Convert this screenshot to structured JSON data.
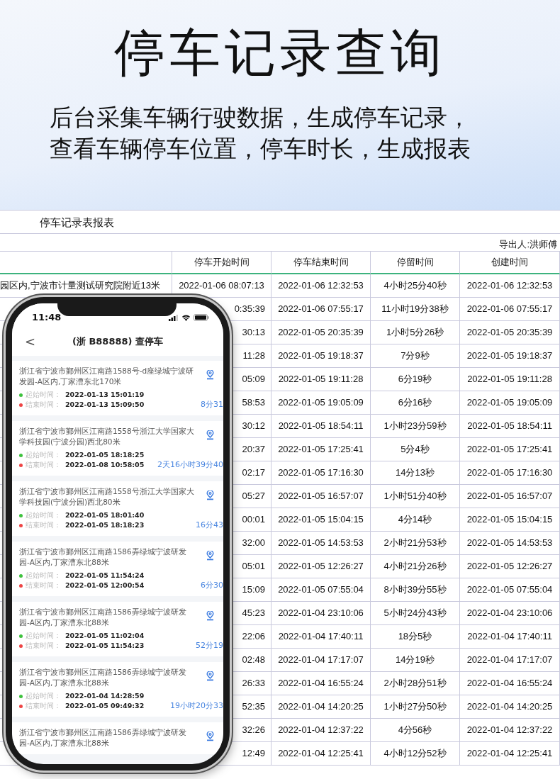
{
  "banner": {
    "title": "停车记录查询",
    "subtitle_lines": [
      "后台采集车辆行驶数据，生成停车记录，",
      "查看车辆停车位置，停车时长，生成报表"
    ]
  },
  "report": {
    "title": "停车记录表报表",
    "exporter": "导出人:洪师傅",
    "columns": [
      "",
      "停车开始时间",
      "停车结束时间",
      "停留时间",
      "创建时间"
    ],
    "rows": [
      [
        "园区内,宁波市计量测试研究院附近13米",
        "2022-01-06 08:07:13",
        "2022-01-06 12:32:53",
        "4小时25分40秒",
        "2022-01-06 12:32:53"
      ],
      [
        "",
        "0:35:39",
        "2022-01-06 07:55:17",
        "11小时19分38秒",
        "2022-01-06 07:55:17"
      ],
      [
        "",
        "30:13",
        "2022-01-05 20:35:39",
        "1小时5分26秒",
        "2022-01-05 20:35:39"
      ],
      [
        "",
        "11:28",
        "2022-01-05 19:18:37",
        "7分9秒",
        "2022-01-05 19:18:37"
      ],
      [
        "",
        "05:09",
        "2022-01-05 19:11:28",
        "6分19秒",
        "2022-01-05 19:11:28"
      ],
      [
        "",
        "58:53",
        "2022-01-05 19:05:09",
        "6分16秒",
        "2022-01-05 19:05:09"
      ],
      [
        "",
        "30:12",
        "2022-01-05 18:54:11",
        "1小时23分59秒",
        "2022-01-05 18:54:11"
      ],
      [
        "",
        "20:37",
        "2022-01-05 17:25:41",
        "5分4秒",
        "2022-01-05 17:25:41"
      ],
      [
        "",
        "02:17",
        "2022-01-05 17:16:30",
        "14分13秒",
        "2022-01-05 17:16:30"
      ],
      [
        "",
        "05:27",
        "2022-01-05 16:57:07",
        "1小时51分40秒",
        "2022-01-05 16:57:07"
      ],
      [
        "",
        "00:01",
        "2022-01-05 15:04:15",
        "4分14秒",
        "2022-01-05 15:04:15"
      ],
      [
        "",
        "32:00",
        "2022-01-05 14:53:53",
        "2小时21分53秒",
        "2022-01-05 14:53:53"
      ],
      [
        "",
        "05:01",
        "2022-01-05 12:26:27",
        "4小时21分26秒",
        "2022-01-05 12:26:27"
      ],
      [
        "",
        "15:09",
        "2022-01-05 07:55:04",
        "8小时39分55秒",
        "2022-01-05 07:55:04"
      ],
      [
        "",
        "45:23",
        "2022-01-04 23:10:06",
        "5小时24分43秒",
        "2022-01-04 23:10:06"
      ],
      [
        "",
        "22:06",
        "2022-01-04 17:40:11",
        "18分5秒",
        "2022-01-04 17:40:11"
      ],
      [
        "",
        "02:48",
        "2022-01-04 17:17:07",
        "14分19秒",
        "2022-01-04 17:17:07"
      ],
      [
        "",
        "26:33",
        "2022-01-04 16:55:24",
        "2小时28分51秒",
        "2022-01-04 16:55:24"
      ],
      [
        "",
        "52:35",
        "2022-01-04 14:20:25",
        "1小时27分50秒",
        "2022-01-04 14:20:25"
      ],
      [
        "",
        "32:26",
        "2022-01-04 12:37:22",
        "4分56秒",
        "2022-01-04 12:37:22"
      ],
      [
        "",
        "12:49",
        "2022-01-04 12:25:41",
        "4小时12分52秒",
        "2022-01-04 12:25:41"
      ]
    ]
  },
  "phone": {
    "status_time": "11:48",
    "back": "<",
    "title": "(浙 B88888) 查停车",
    "records": [
      {
        "address": "浙江省宁波市鄞州区江南路1588号-d座绿城宁波研发园-A区内,丁家漕东北170米",
        "start_label": "起始时间：",
        "start": "2022-01-13 15:01:19",
        "end_label": "结束时间：",
        "end": "2022-01-13 15:09:50",
        "duration": "8分31"
      },
      {
        "address": "浙江省宁波市鄞州区江南路1558号浙江大学国家大学科技园(宁波分园)西北80米",
        "start_label": "起始时间：",
        "start": "2022-01-05 18:18:25",
        "end_label": "结束时间：",
        "end": "2022-01-08 10:58:05",
        "duration": "2天16小时39分40"
      },
      {
        "address": "浙江省宁波市鄞州区江南路1558号浙江大学国家大学科技园(宁波分园)西北80米",
        "start_label": "起始时间：",
        "start": "2022-01-05 18:01:40",
        "end_label": "结束时间：",
        "end": "2022-01-05 18:18:23",
        "duration": "16分43"
      },
      {
        "address": "浙江省宁波市鄞州区江南路1586弄绿城宁波研发园-A区内,丁家漕东北88米",
        "start_label": "起始时间：",
        "start": "2022-01-05 11:54:24",
        "end_label": "结束时间：",
        "end": "2022-01-05 12:00:54",
        "duration": "6分30"
      },
      {
        "address": "浙江省宁波市鄞州区江南路1586弄绿城宁波研发园-A区内,丁家漕东北88米",
        "start_label": "起始时间：",
        "start": "2022-01-05 11:02:04",
        "end_label": "结束时间：",
        "end": "2022-01-05 11:54:23",
        "duration": "52分19"
      },
      {
        "address": "浙江省宁波市鄞州区江南路1586弄绿城宁波研发园-A区内,丁家漕东北88米",
        "start_label": "起始时间：",
        "start": "2022-01-04 14:28:59",
        "end_label": "结束时间：",
        "end": "2022-01-05 09:49:32",
        "duration": "19小时20分33"
      },
      {
        "address": "浙江省宁波市鄞州区江南路1586弄绿城宁波研发园-A区内,丁家漕东北88米"
      }
    ]
  }
}
